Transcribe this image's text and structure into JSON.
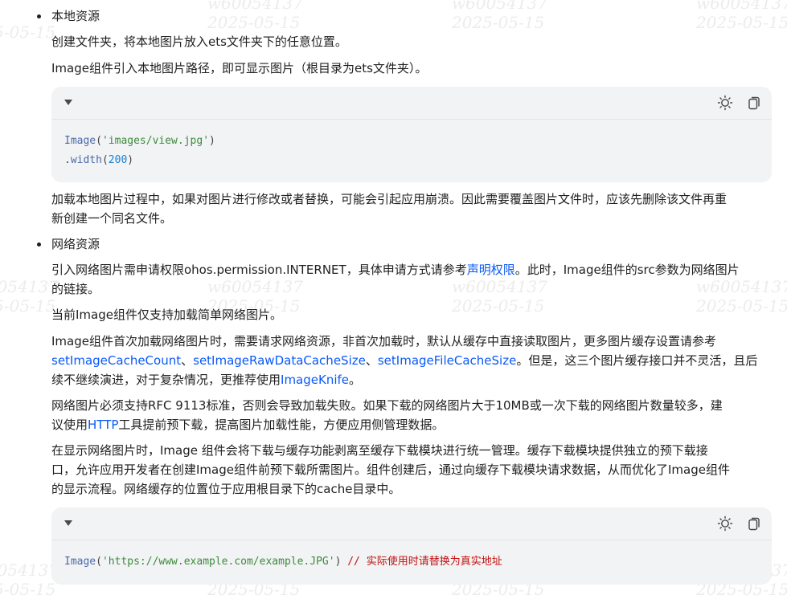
{
  "watermark": {
    "id": "w60054137",
    "date": "2025-05-15"
  },
  "local": {
    "heading": "本地资源",
    "p1": "创建文件夹，将本地图片放入ets文件夹下的任意位置。",
    "p2": "Image组件引入本地图片路径，即可显示图片（根目录为ets文件夹）。",
    "code": {
      "l1_fn": "Image",
      "l1_open": "(",
      "l1_str": "'images/view.jpg'",
      "l1_close": ")",
      "l2_dot": ".",
      "l2_fn": "width",
      "l2_open": "(",
      "l2_num": "200",
      "l2_close": ")"
    },
    "note_l1": "加载本地图片过程中，如果对图片进行修改或者替换，可能会引起应用崩溃。因此需要覆盖图片文件时，应该先删除该文件再重",
    "note_l2": "新创建一个同名文件。"
  },
  "network": {
    "heading": "网络资源",
    "p1_a": "引入网络图片需申请权限ohos.permission.INTERNET，具体申请方式请参考",
    "p1_link": "声明权限",
    "p1_b": "。此时，Image组件的src参数为网络图片",
    "p1_l2": "的链接。",
    "p2": "当前Image组件仅支持加载简单网络图片。",
    "p3_l1": "Image组件首次加载网络图片时，需要请求网络资源，非首次加载时，默认从缓存中直接读取图片，更多图片缓存设置请参考",
    "p3_link1": "setImageCacheCount",
    "p3_sep1": "、",
    "p3_link2": "setImageRawDataCacheSize",
    "p3_sep2": "、",
    "p3_link3": "setImageFileCacheSize",
    "p3_tail": "。但是，这三个图片缓存接口并不灵活，且后",
    "p3_l3_a": "续不继续演进，对于复杂情况，更推荐使用",
    "p3_link4": "ImageKnife",
    "p3_l3_b": "。",
    "p4_l1": "网络图片必须支持RFC 9113标准，否则会导致加载失败。如果下载的网络图片大于10MB或一次下载的网络图片数量较多，建",
    "p4_l2_a": "议使用",
    "p4_link": "HTTP",
    "p4_l2_b": "工具提前预下载，提高图片加载性能，方便应用侧管理数据。",
    "p5_l1": "在显示网络图片时，Image 组件会将下载与缓存功能剥离至缓存下载模块进行统一管理。缓存下载模块提供独立的预下载接",
    "p5_l2": "口，允许应用开发者在创建Image组件前预下载所需图片。组件创建后，通过向缓存下载模块请求数据，从而优化了Image组件",
    "p5_l3": "的显示流程。网络缓存的位置位于应用根目录下的cache目录中。",
    "code": {
      "fn": "Image",
      "open": "(",
      "str": "'https://www.example.com/example.JPG'",
      "close": ")",
      "comment": "// 实际使用时请替换为真实地址"
    }
  },
  "icons": {
    "collapse": "caret-down-icon",
    "theme": "sun-icon",
    "copy": "copy-icon"
  }
}
